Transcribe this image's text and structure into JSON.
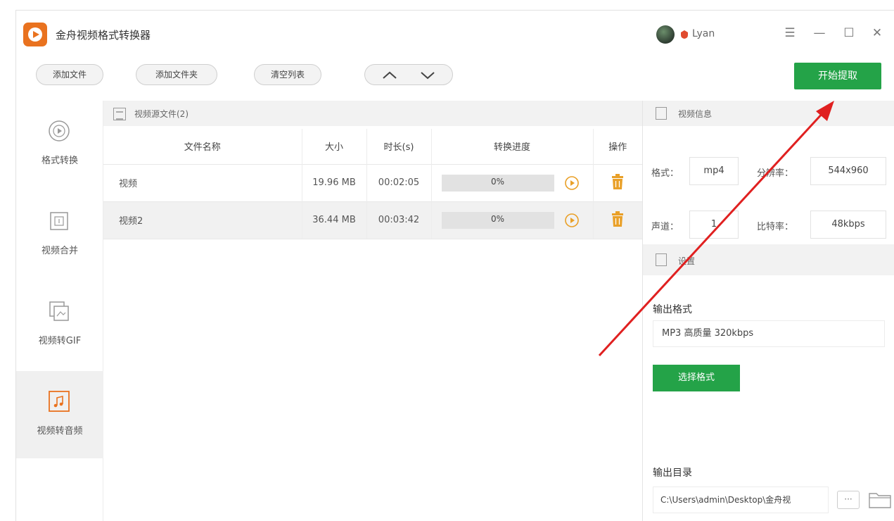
{
  "app": {
    "title": "金舟视频格式转换器",
    "username": "Lyan",
    "colors": {
      "accent": "#24a348",
      "logo": "#e9721f",
      "vip": "#e04b2f",
      "annotation_arrow": "#e02020"
    }
  },
  "window_controls": {
    "menu": "☰",
    "minimize": "—",
    "maximize": "☐",
    "close": "✕"
  },
  "toolbar": {
    "add_file": "添加文件",
    "add_folder": "添加文件夹",
    "clear_list": "清空列表",
    "start": "开始提取"
  },
  "sidebar": {
    "items": [
      {
        "label": "格式转换",
        "icon": "play-circle-icon",
        "active": false
      },
      {
        "label": "视频合并",
        "icon": "merge-icon",
        "active": false
      },
      {
        "label": "视频转GIF",
        "icon": "gif-icon",
        "active": false
      },
      {
        "label": "视频转音频",
        "icon": "music-note-icon",
        "active": true
      }
    ]
  },
  "file_list": {
    "header": "视频源文件(2)",
    "columns": [
      "文件名称",
      "大小",
      "时长(s)",
      "转换进度",
      "操作"
    ],
    "rows": [
      {
        "name": "视频",
        "size": "19.96 MB",
        "duration": "00:02:05",
        "progress_text": "0%",
        "progress": 0
      },
      {
        "name": "视频2",
        "size": "36.44 MB",
        "duration": "00:03:42",
        "progress_text": "0%",
        "progress": 0
      }
    ]
  },
  "video_info": {
    "header": "视频信息",
    "format_label": "格式：",
    "format_value": "mp4",
    "resolution_label": "分辨率：",
    "resolution_value": "544x960",
    "channel_label": "声道：",
    "channel_value": "1",
    "bitrate_label": "比特率：",
    "bitrate_value": "48kbps"
  },
  "settings": {
    "header": "设置",
    "output_format_label": "输出格式",
    "output_format_value": "MP3 高质量 320kbps",
    "choose_format": "选择格式",
    "output_dir_label": "输出目录",
    "output_dir_value": "C:\\Users\\admin\\Desktop\\金舟视",
    "dots": "···"
  }
}
